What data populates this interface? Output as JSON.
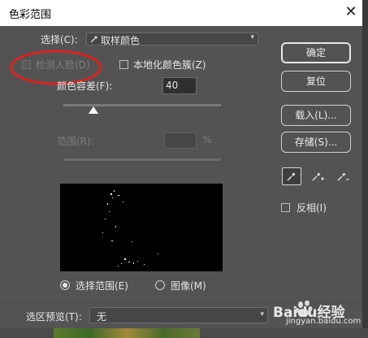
{
  "dialog": {
    "title": "色彩范围",
    "close_glyph": "✕"
  },
  "select": {
    "label": "选择(C):",
    "value": "取样颜色"
  },
  "detect_faces": {
    "label": "检测人脸(D)"
  },
  "localized_clusters": {
    "label": "本地化颜色簇(Z)"
  },
  "fuzziness": {
    "label": "颜色容差(F):",
    "value": "40"
  },
  "range": {
    "label": "范围(R):",
    "value": "",
    "unit": "%"
  },
  "buttons": {
    "ok": "确定",
    "reset": "复位",
    "load": "载入(L)...",
    "save": "存储(S)..."
  },
  "invert": {
    "label": "反相(I)"
  },
  "view": {
    "selection_label": "选择范围(E)",
    "image_label": "图像(M)",
    "selected": "selection"
  },
  "preview": {
    "label": "选区预览(T):",
    "value": "无"
  },
  "watermark": {
    "brand": "Baidu经验",
    "url": "jingyan.baidu.com"
  },
  "colors": {
    "annotation": "#d8231f"
  },
  "icons": [
    "eyedropper-icon",
    "eyedropper-plus-icon",
    "eyedropper-minus-icon"
  ]
}
